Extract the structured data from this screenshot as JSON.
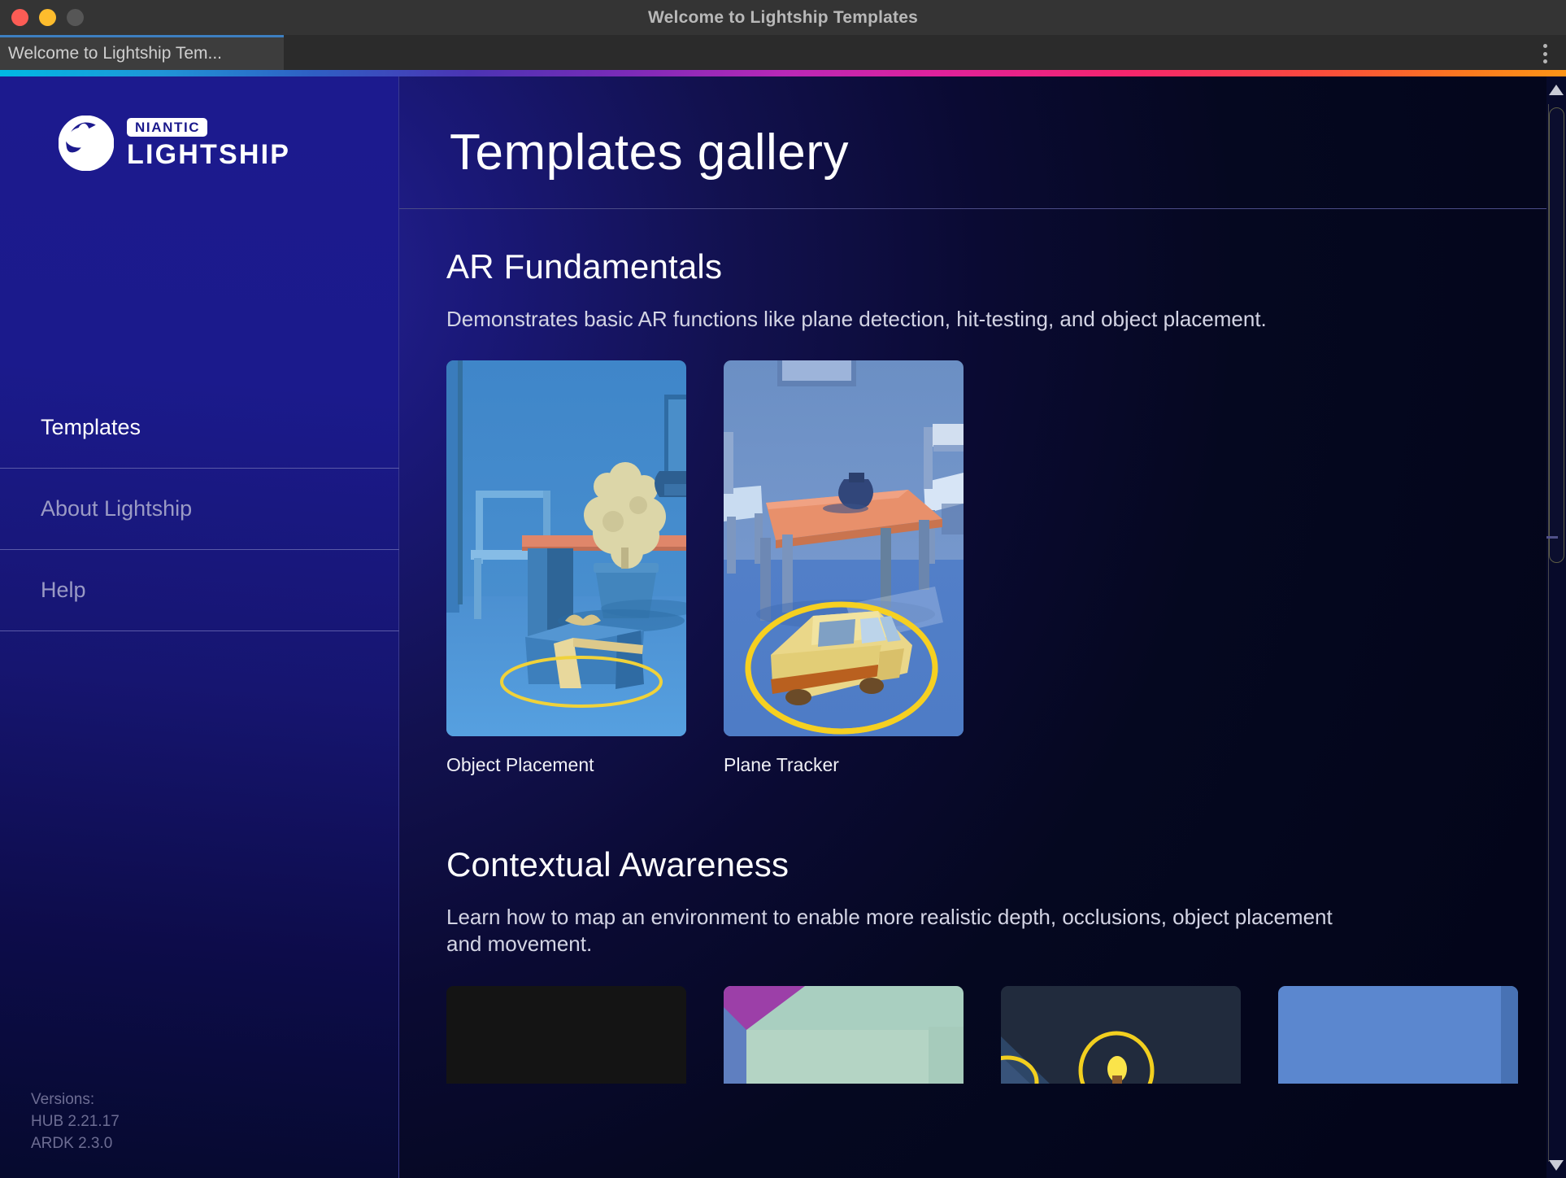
{
  "window": {
    "title": "Welcome to Lightship Templates",
    "traffic_lights": [
      "close-red",
      "minimize-yellow",
      "zoom-grey"
    ],
    "menu_icon": "kebab-menu-icon"
  },
  "tabs": [
    {
      "label": "Welcome to Lightship Tem...",
      "active": true
    }
  ],
  "sidebar": {
    "logo": {
      "mark": "niantic-lightship-globe-arrow-icon",
      "badge": "NIANTIC",
      "word": "LIGHTSHIP"
    },
    "items": [
      {
        "label": "Templates",
        "active": true
      },
      {
        "label": "About Lightship",
        "active": false
      },
      {
        "label": "Help",
        "active": false
      }
    ],
    "versions": {
      "heading": "Versions:",
      "hub": "HUB 2.21.17",
      "ardk": "ARDK 2.3.0"
    }
  },
  "main": {
    "page_title": "Templates gallery",
    "sections": [
      {
        "title": "AR Fundamentals",
        "description": "Demonstrates basic AR functions like plane detection, hit-testing, and object placement.",
        "cards": [
          {
            "label": "Object Placement",
            "thumb": "room-gift-box-scene"
          },
          {
            "label": "Plane Tracker",
            "thumb": "room-yellow-car-scene"
          }
        ]
      },
      {
        "title": "Contextual Awareness",
        "description": "Learn how to map an environment to enable more realistic depth, occlusions, object placement and movement.",
        "cards": [
          {
            "label": "",
            "thumb": "dark-scene"
          },
          {
            "label": "",
            "thumb": "purple-green-room-scene"
          },
          {
            "label": "",
            "thumb": "night-flame-ring-scene"
          },
          {
            "label": "",
            "thumb": "blue-wall-scene"
          }
        ]
      }
    ]
  },
  "scrollbar": {
    "up_icon": "scroll-up-arrow-icon",
    "down_icon": "scroll-down-arrow-icon"
  },
  "colors": {
    "accent_blue": "#3d7fc1",
    "sidebar_blue": "#1b1a8c",
    "main_dark": "#060a2e",
    "rainbow": [
      "#00b9e4",
      "#2f5fc4",
      "#7b2bb8",
      "#b828b8",
      "#e0219b",
      "#f5256d",
      "#fb7a1e"
    ]
  }
}
